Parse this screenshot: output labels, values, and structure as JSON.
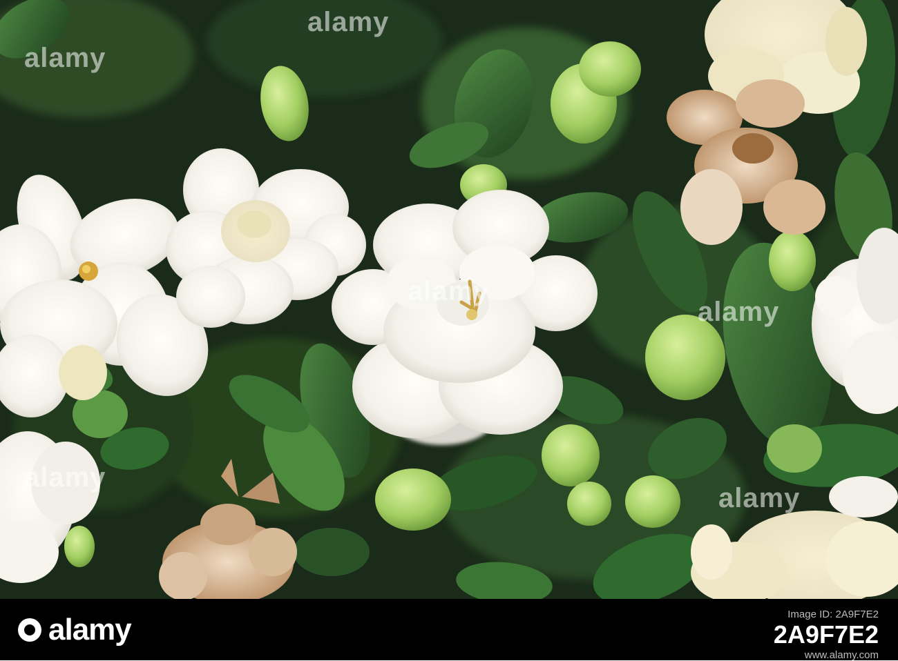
{
  "watermark": {
    "brand": "alamy"
  },
  "footer": {
    "brand": "alamy",
    "label": "Image ID: 2A9F7E2",
    "image_id": "2A9F7E2",
    "url": "www.alamy.com"
  },
  "colors": {
    "foliage_dark": "#1c2d1a",
    "leaf_green": "#2f5a2c",
    "bud_green": "#a8d26a",
    "petal_white": "#f7f5ee",
    "petal_cream": "#efe8c8",
    "wilted_brown": "#c9a47e",
    "footer_bg": "#000000"
  }
}
